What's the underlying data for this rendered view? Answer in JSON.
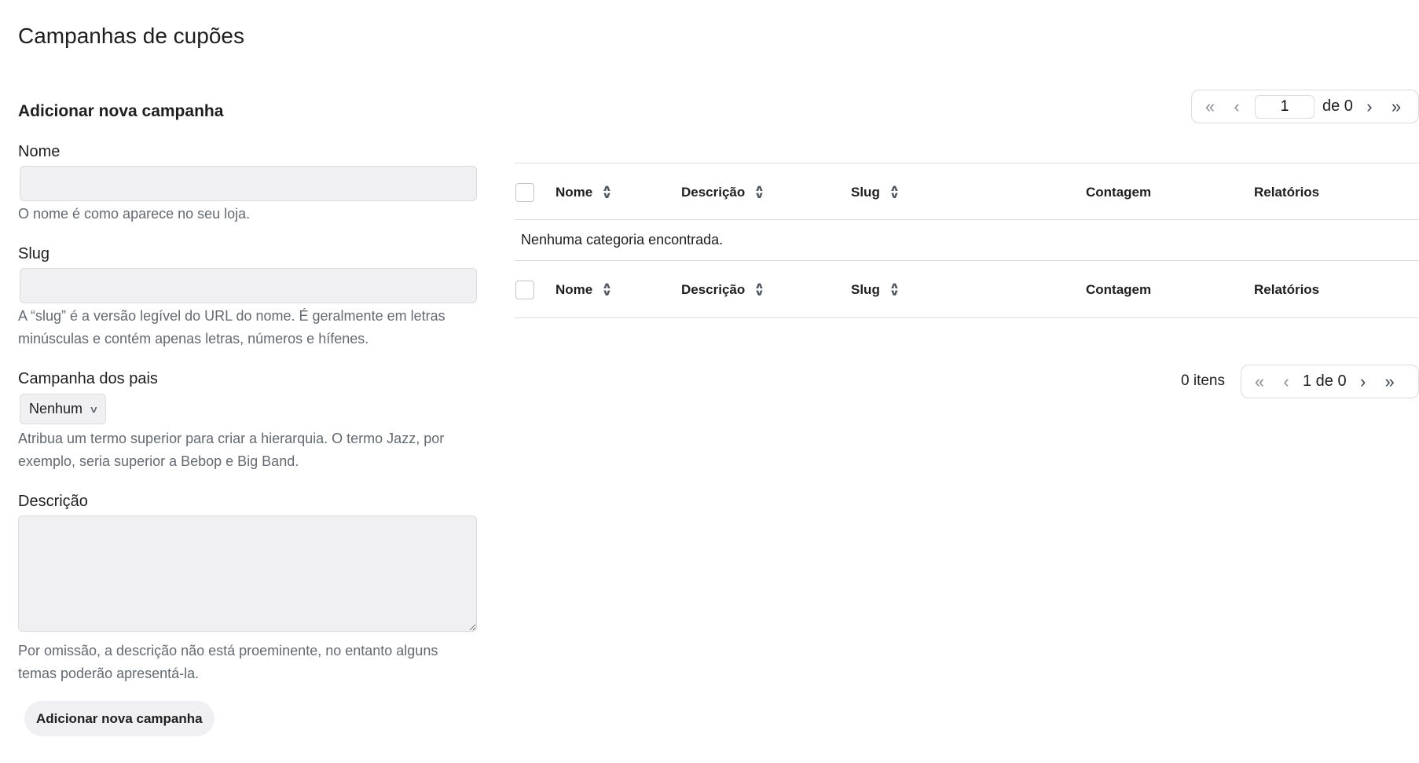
{
  "page": {
    "title": "Campanhas de cupões"
  },
  "form": {
    "heading": "Adicionar nova campanha",
    "name": {
      "label": "Nome",
      "value": "",
      "help": "O nome é como aparece no seu loja."
    },
    "slug": {
      "label": "Slug",
      "value": "",
      "help": "A “slug” é a versão legível do URL do nome. É geralmente em letras minúsculas e contém apenas letras, números e hífenes."
    },
    "parent": {
      "label": "Campanha dos pais",
      "selected": "Nenhum",
      "help": "Atribua um termo superior para criar a hierarquia. O termo Jazz, por exemplo, seria superior a Bebop e Big Band."
    },
    "description": {
      "label": "Descrição",
      "value": "",
      "help": "Por omissão, a descrição não está proeminente, no entanto alguns temas poderão apresentá-la."
    },
    "submit_label": "Adicionar nova campanha"
  },
  "pagination_top": {
    "first": "«",
    "prev": "‹",
    "current_page": "1",
    "of_total": "de 0",
    "next": "›",
    "last": "»"
  },
  "table": {
    "columns": [
      "Nome",
      "Descrição",
      "Slug",
      "Contagem",
      "Relatórios"
    ],
    "empty_message": "Nenhuma categoria encontrada."
  },
  "pagination_bottom": {
    "items": "0 itens",
    "first": "«",
    "prev": "‹",
    "status": "1 de 0",
    "next": "›",
    "last": "»"
  }
}
